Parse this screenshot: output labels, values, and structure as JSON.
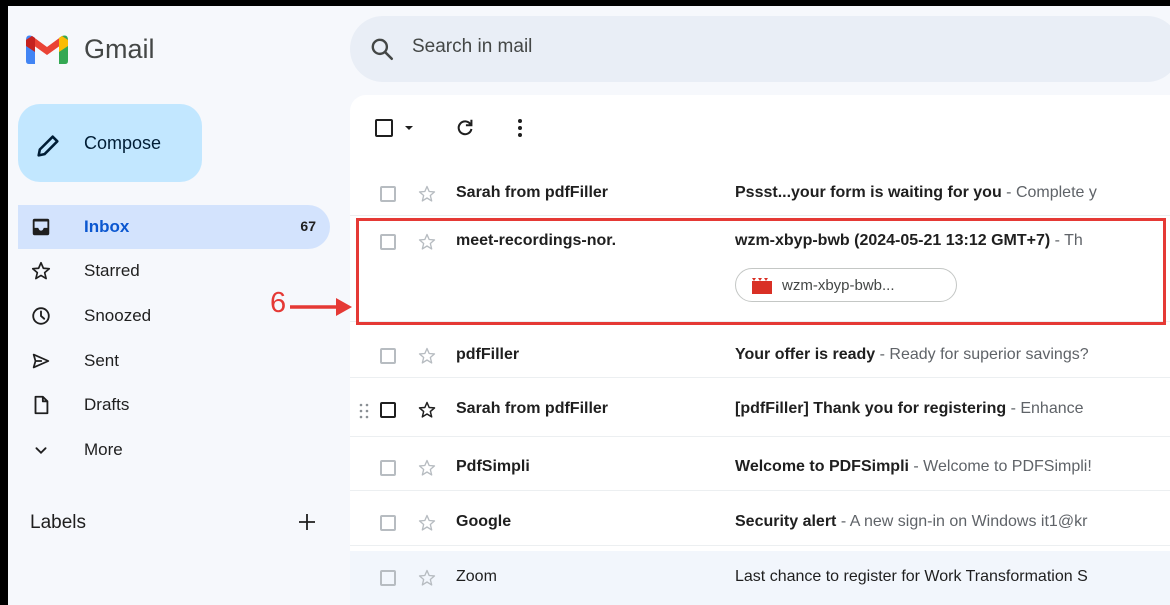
{
  "app": {
    "name": "Gmail"
  },
  "search": {
    "placeholder": "Search in mail"
  },
  "compose": {
    "label": "Compose"
  },
  "nav": [
    {
      "id": "inbox",
      "label": "Inbox",
      "count": "67",
      "icon": "inbox-icon",
      "active": true
    },
    {
      "id": "starred",
      "label": "Starred",
      "icon": "star-icon"
    },
    {
      "id": "snoozed",
      "label": "Snoozed",
      "icon": "clock-icon"
    },
    {
      "id": "sent",
      "label": "Sent",
      "icon": "send-icon"
    },
    {
      "id": "drafts",
      "label": "Drafts",
      "icon": "draft-icon"
    },
    {
      "id": "more",
      "label": "More",
      "icon": "chevron-down-icon"
    }
  ],
  "labels": {
    "heading": "Labels"
  },
  "emails": [
    {
      "sender": "Sarah from pdfFiller",
      "subject": "Pssst...your form is waiting for you",
      "snippet": " - Complete y",
      "unread": true
    },
    {
      "sender": "meet-recordings-nor.",
      "subject": "wzm-xbyp-bwb (2024-05-21 13:12 GMT+7)",
      "snippet": " - Th",
      "unread": true,
      "attachment": "wzm-xbyp-bwb..."
    },
    {
      "sender": "pdfFiller",
      "subject": "Your offer is ready",
      "snippet": " - Ready for superior savings?",
      "unread": true
    },
    {
      "sender": "Sarah from pdfFiller",
      "subject": "[pdfFiller] Thank you for registering",
      "snippet": " - Enhance",
      "unread": true
    },
    {
      "sender": "PdfSimpli",
      "subject": "Welcome to PDFSimpli",
      "snippet": " - Welcome to PDFSimpli!",
      "unread": true
    },
    {
      "sender": "Google",
      "subject": "Security alert",
      "snippet": " - A new sign-in on Windows it1@kr",
      "unread": true
    },
    {
      "sender": "Zoom",
      "subject": "",
      "snippet": "Last chance to register for Work Transformation S",
      "unread": false
    }
  ],
  "annotation": {
    "number": "6"
  },
  "colors": {
    "accent": "#0b57d0",
    "highlight": "#e53935",
    "compose_bg": "#c2e7ff",
    "active_nav": "#d3e3fd"
  }
}
